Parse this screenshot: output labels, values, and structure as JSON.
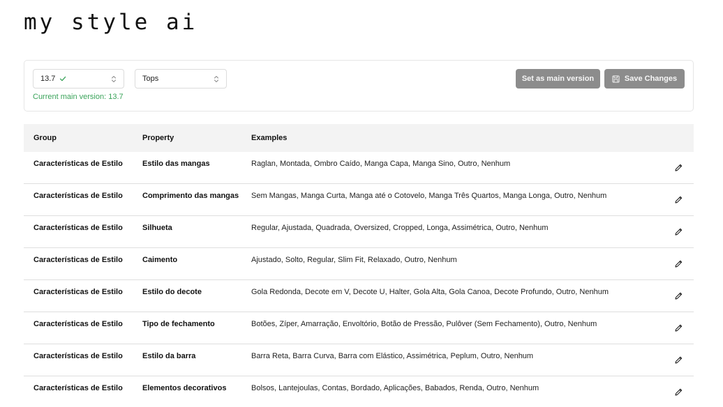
{
  "app": {
    "title": "my style ai"
  },
  "controls": {
    "version_value": "13.7",
    "category_value": "Tops",
    "main_version_note": "Current main version: 13.7",
    "set_main_label": "Set as main version",
    "save_label": "Save Changes"
  },
  "colors": {
    "success": "#3aa35a",
    "button_bg": "#8c8c8c",
    "header_bg": "#f3f3f3"
  },
  "table": {
    "headers": {
      "group": "Group",
      "property": "Property",
      "examples": "Examples"
    },
    "rows": [
      {
        "group": "Características de Estilo",
        "property": "Estilo das mangas",
        "examples": "Raglan, Montada, Ombro Caído, Manga Capa, Manga Sino, Outro, Nenhum"
      },
      {
        "group": "Características de Estilo",
        "property": "Comprimento das mangas",
        "examples": "Sem Mangas, Manga Curta, Manga até o Cotovelo, Manga Três Quartos, Manga Longa, Outro, Nenhum"
      },
      {
        "group": "Características de Estilo",
        "property": "Silhueta",
        "examples": "Regular, Ajustada, Quadrada, Oversized, Cropped, Longa, Assimétrica, Outro, Nenhum"
      },
      {
        "group": "Características de Estilo",
        "property": "Caimento",
        "examples": "Ajustado, Solto, Regular, Slim Fit, Relaxado, Outro, Nenhum"
      },
      {
        "group": "Características de Estilo",
        "property": "Estilo do decote",
        "examples": "Gola Redonda, Decote em V, Decote U, Halter, Gola Alta, Gola Canoa, Decote Profundo, Outro, Nenhum"
      },
      {
        "group": "Características de Estilo",
        "property": "Tipo de fechamento",
        "examples": "Botões, Zíper, Amarração, Envoltório, Botão de Pressão, Pulôver (Sem Fechamento), Outro, Nenhum"
      },
      {
        "group": "Características de Estilo",
        "property": "Estilo da barra",
        "examples": "Barra Reta, Barra Curva, Barra com Elástico, Assimétrica, Peplum, Outro, Nenhum"
      },
      {
        "group": "Características de Estilo",
        "property": "Elementos decorativos",
        "examples": "Bolsos, Lantejoulas, Contas, Bordado, Aplicações, Babados, Renda, Outro, Nenhum"
      }
    ]
  }
}
